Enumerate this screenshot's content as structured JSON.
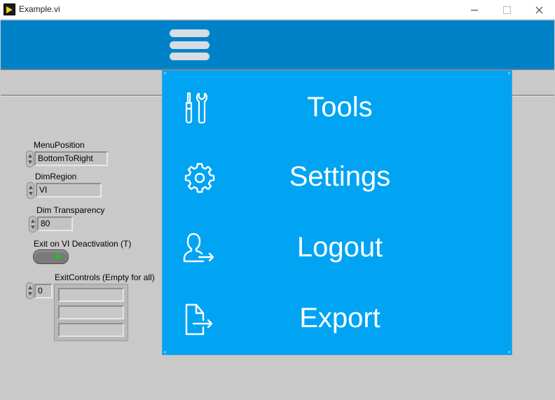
{
  "window": {
    "title": "Example.vi",
    "minimize_glyph": "",
    "maximize_glyph": "",
    "close_glyph": ""
  },
  "colors": {
    "header_blue": "#0082c8",
    "menu_blue": "#00a4f3",
    "panel_gray": "#c9c9c9",
    "led_green": "#22c21d"
  },
  "controls": {
    "menu_position": {
      "label": "MenuPosition",
      "value": "BottomToRight"
    },
    "dim_region": {
      "label": "DimRegion",
      "value": "VI"
    },
    "dim_transparency": {
      "label": "Dim Transparency",
      "value": "80"
    },
    "exit_on_deactivation": {
      "label": "Exit on VI Deactivation (T)",
      "state": true
    },
    "exit_controls": {
      "label": "ExitControls (Empty for all)",
      "index": "0",
      "elements": [
        "",
        "",
        ""
      ]
    }
  },
  "menu": {
    "items": [
      {
        "label": "Tools",
        "icon": "tools-icon"
      },
      {
        "label": "Settings",
        "icon": "gear-icon"
      },
      {
        "label": "Logout",
        "icon": "logout-user-icon"
      },
      {
        "label": "Export",
        "icon": "export-file-icon"
      }
    ]
  }
}
